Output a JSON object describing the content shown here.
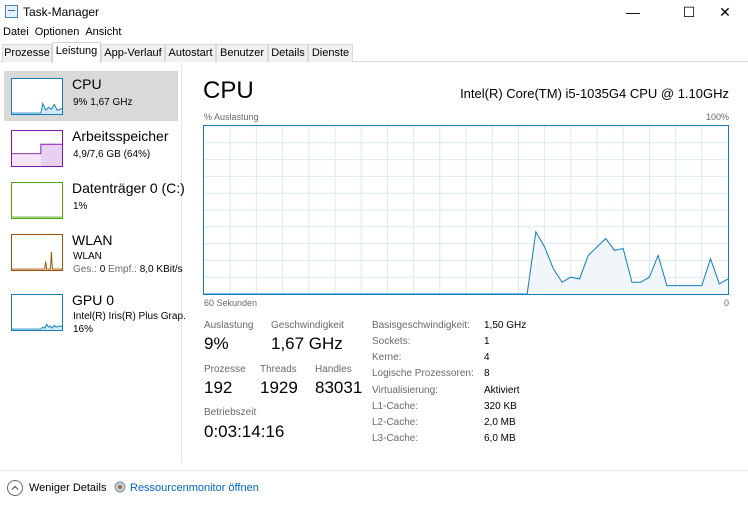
{
  "window": {
    "title": "Task-Manager",
    "minimize": "—",
    "maximize": "☐",
    "close": "✕"
  },
  "menu": [
    "Datei",
    "Optionen",
    "Ansicht"
  ],
  "tabs": [
    "Prozesse",
    "Leistung",
    "App-Verlauf",
    "Autostart",
    "Benutzer",
    "Details",
    "Dienste"
  ],
  "active_tab": "Leistung",
  "sidebar": {
    "cpu": {
      "title": "CPU",
      "sub": "9%  1,67 GHz",
      "color": "#117dbb"
    },
    "memory": {
      "title": "Arbeitsspeicher",
      "sub": "4,9/7,6 GB (64%)",
      "color": "#8b12ae"
    },
    "disk": {
      "title": "Datenträger 0 (C:)",
      "sub": "1%",
      "color": "#4da60c"
    },
    "wlan": {
      "title": "WLAN",
      "sub1": "WLAN",
      "sub2_label1": "Ges.:",
      "sub2_val1": "0",
      "sub2_label2": "Empf.:",
      "sub2_val2": "8,0 KBit/s",
      "color": "#a74f01"
    },
    "gpu": {
      "title": "GPU 0",
      "sub1": "Intel(R) Iris(R) Plus Grap.",
      "sub2": "16%",
      "color": "#117dbb"
    }
  },
  "main": {
    "title": "CPU",
    "model": "Intel(R) Core(TM) i5-1035G4 CPU @ 1.10GHz",
    "y_label": "% Auslastung",
    "y_max": "100%",
    "x_left": "60 Sekunden",
    "x_right": "0"
  },
  "chart_data": {
    "type": "area",
    "xlabel": "60 Sekunden",
    "ylabel": "% Auslastung",
    "xlim": [
      60,
      0
    ],
    "ylim": [
      0,
      100
    ],
    "grid": true,
    "color": "#117dbb",
    "x": [
      60,
      59,
      58,
      57,
      56,
      55,
      54,
      53,
      52,
      51,
      50,
      49,
      48,
      47,
      46,
      45,
      44,
      43,
      42,
      41,
      40,
      39,
      38,
      37,
      36,
      35,
      34,
      33,
      32,
      31,
      30,
      29,
      28,
      27,
      26,
      25,
      24,
      23,
      22,
      21,
      20,
      19,
      18,
      17,
      16,
      15,
      14,
      13,
      12,
      11,
      10,
      9,
      8,
      7,
      6,
      5,
      4,
      3,
      2,
      1,
      0
    ],
    "values": [
      0,
      0,
      0,
      0,
      0,
      0,
      0,
      0,
      0,
      0,
      0,
      0,
      0,
      0,
      0,
      0,
      0,
      0,
      0,
      0,
      0,
      0,
      0,
      0,
      0,
      0,
      0,
      0,
      0,
      0,
      0,
      0,
      0,
      0,
      0,
      0,
      0,
      0,
      37,
      28,
      15,
      7,
      10,
      9,
      23,
      28,
      33,
      26,
      27,
      7,
      7,
      10,
      23,
      5,
      5,
      5,
      5,
      5,
      21,
      6,
      9
    ]
  },
  "stats": {
    "auslastung_label": "Auslastung",
    "auslastung": "9%",
    "geschwindigkeit_label": "Geschwindigkeit",
    "geschwindigkeit": "1,67 GHz",
    "prozesse_label": "Prozesse",
    "prozesse": "192",
    "threads_label": "Threads",
    "threads": "1929",
    "handles_label": "Handles",
    "handles": "83031",
    "betriebszeit_label": "Betriebszeit",
    "betriebszeit": "0:03:14:16"
  },
  "info": [
    {
      "label": "Basisgeschwindigkeit:",
      "value": "1,50 GHz"
    },
    {
      "label": "Sockets:",
      "value": "1"
    },
    {
      "label": "Kerne:",
      "value": "4"
    },
    {
      "label": "Logische Prozessoren:",
      "value": "8"
    },
    {
      "label": "Virtualisierung:",
      "value": "Aktiviert"
    },
    {
      "label": "L1-Cache:",
      "value": "320 KB"
    },
    {
      "label": "L2-Cache:",
      "value": "2,0 MB"
    },
    {
      "label": "L3-Cache:",
      "value": "6,0 MB"
    }
  ],
  "footer": {
    "fewer_details": "Weniger Details",
    "resmon": "Ressourcenmonitor öffnen"
  }
}
